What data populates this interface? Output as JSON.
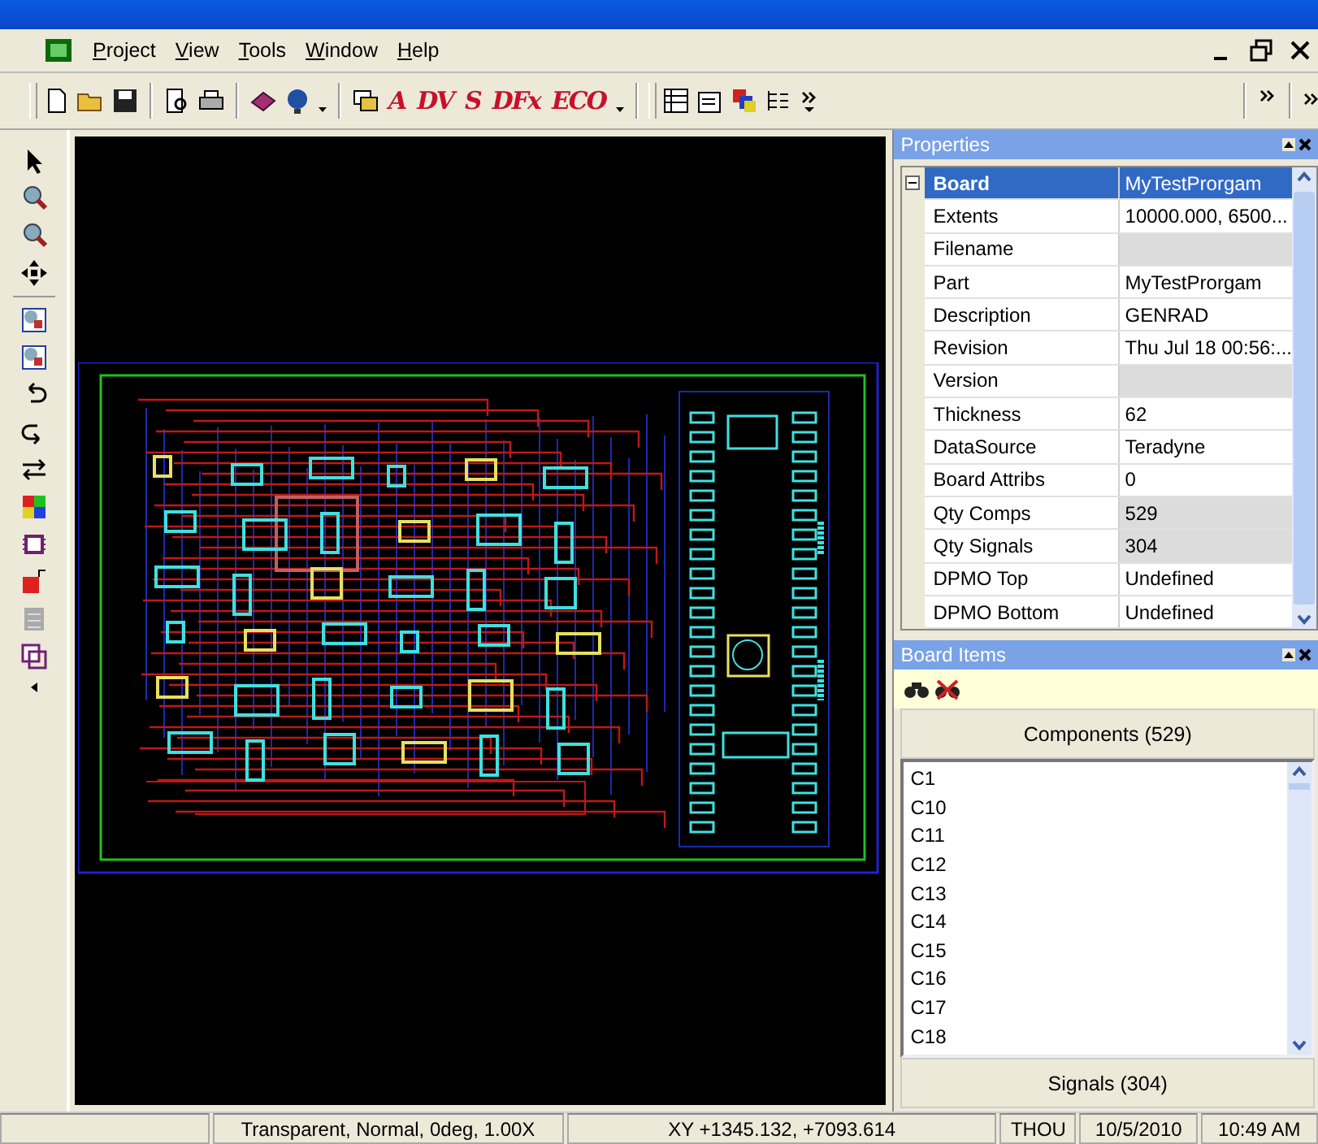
{
  "menu": {
    "items": [
      "Project",
      "View",
      "Tools",
      "Window",
      "Help"
    ]
  },
  "toolbar": {
    "text_buttons": [
      "A",
      "DV",
      "S",
      "DFx",
      "ECO"
    ]
  },
  "properties": {
    "title": "Properties",
    "rows": [
      {
        "name": "Board",
        "value": "MyTestProrgam",
        "selected": true,
        "greyed": false
      },
      {
        "name": "Extents",
        "value": "10000.000, 6500...",
        "selected": false,
        "greyed": false
      },
      {
        "name": "Filename",
        "value": "",
        "selected": false,
        "greyed": true
      },
      {
        "name": "Part",
        "value": "MyTestProrgam",
        "selected": false,
        "greyed": false
      },
      {
        "name": "Description",
        "value": "GENRAD",
        "selected": false,
        "greyed": false
      },
      {
        "name": "Revision",
        "value": "Thu Jul 18 00:56:...",
        "selected": false,
        "greyed": false
      },
      {
        "name": "Version",
        "value": "",
        "selected": false,
        "greyed": true
      },
      {
        "name": "Thickness",
        "value": "62",
        "selected": false,
        "greyed": false
      },
      {
        "name": "DataSource",
        "value": "Teradyne",
        "selected": false,
        "greyed": false
      },
      {
        "name": "Board Attribs",
        "value": "0",
        "selected": false,
        "greyed": false
      },
      {
        "name": "Qty Comps",
        "value": "529",
        "selected": false,
        "greyed": true
      },
      {
        "name": "Qty Signals",
        "value": "304",
        "selected": false,
        "greyed": true
      },
      {
        "name": "DPMO Top",
        "value": "Undefined",
        "selected": false,
        "greyed": false
      },
      {
        "name": "DPMO Bottom",
        "value": "Undefined",
        "selected": false,
        "greyed": false
      }
    ]
  },
  "board_items": {
    "title": "Board Items",
    "components_button": "Components (529)",
    "items": [
      "C1",
      "C10",
      "C11",
      "C12",
      "C13",
      "C14",
      "C15",
      "C16",
      "C17",
      "C18"
    ],
    "signals_button": "Signals (304)"
  },
  "status_bar": [
    "Transparent, Normal, 0deg, 1.00X",
    "XY  +1345.132, +7093.614",
    "THOU",
    "10/5/2010",
    "10:49 AM"
  ]
}
